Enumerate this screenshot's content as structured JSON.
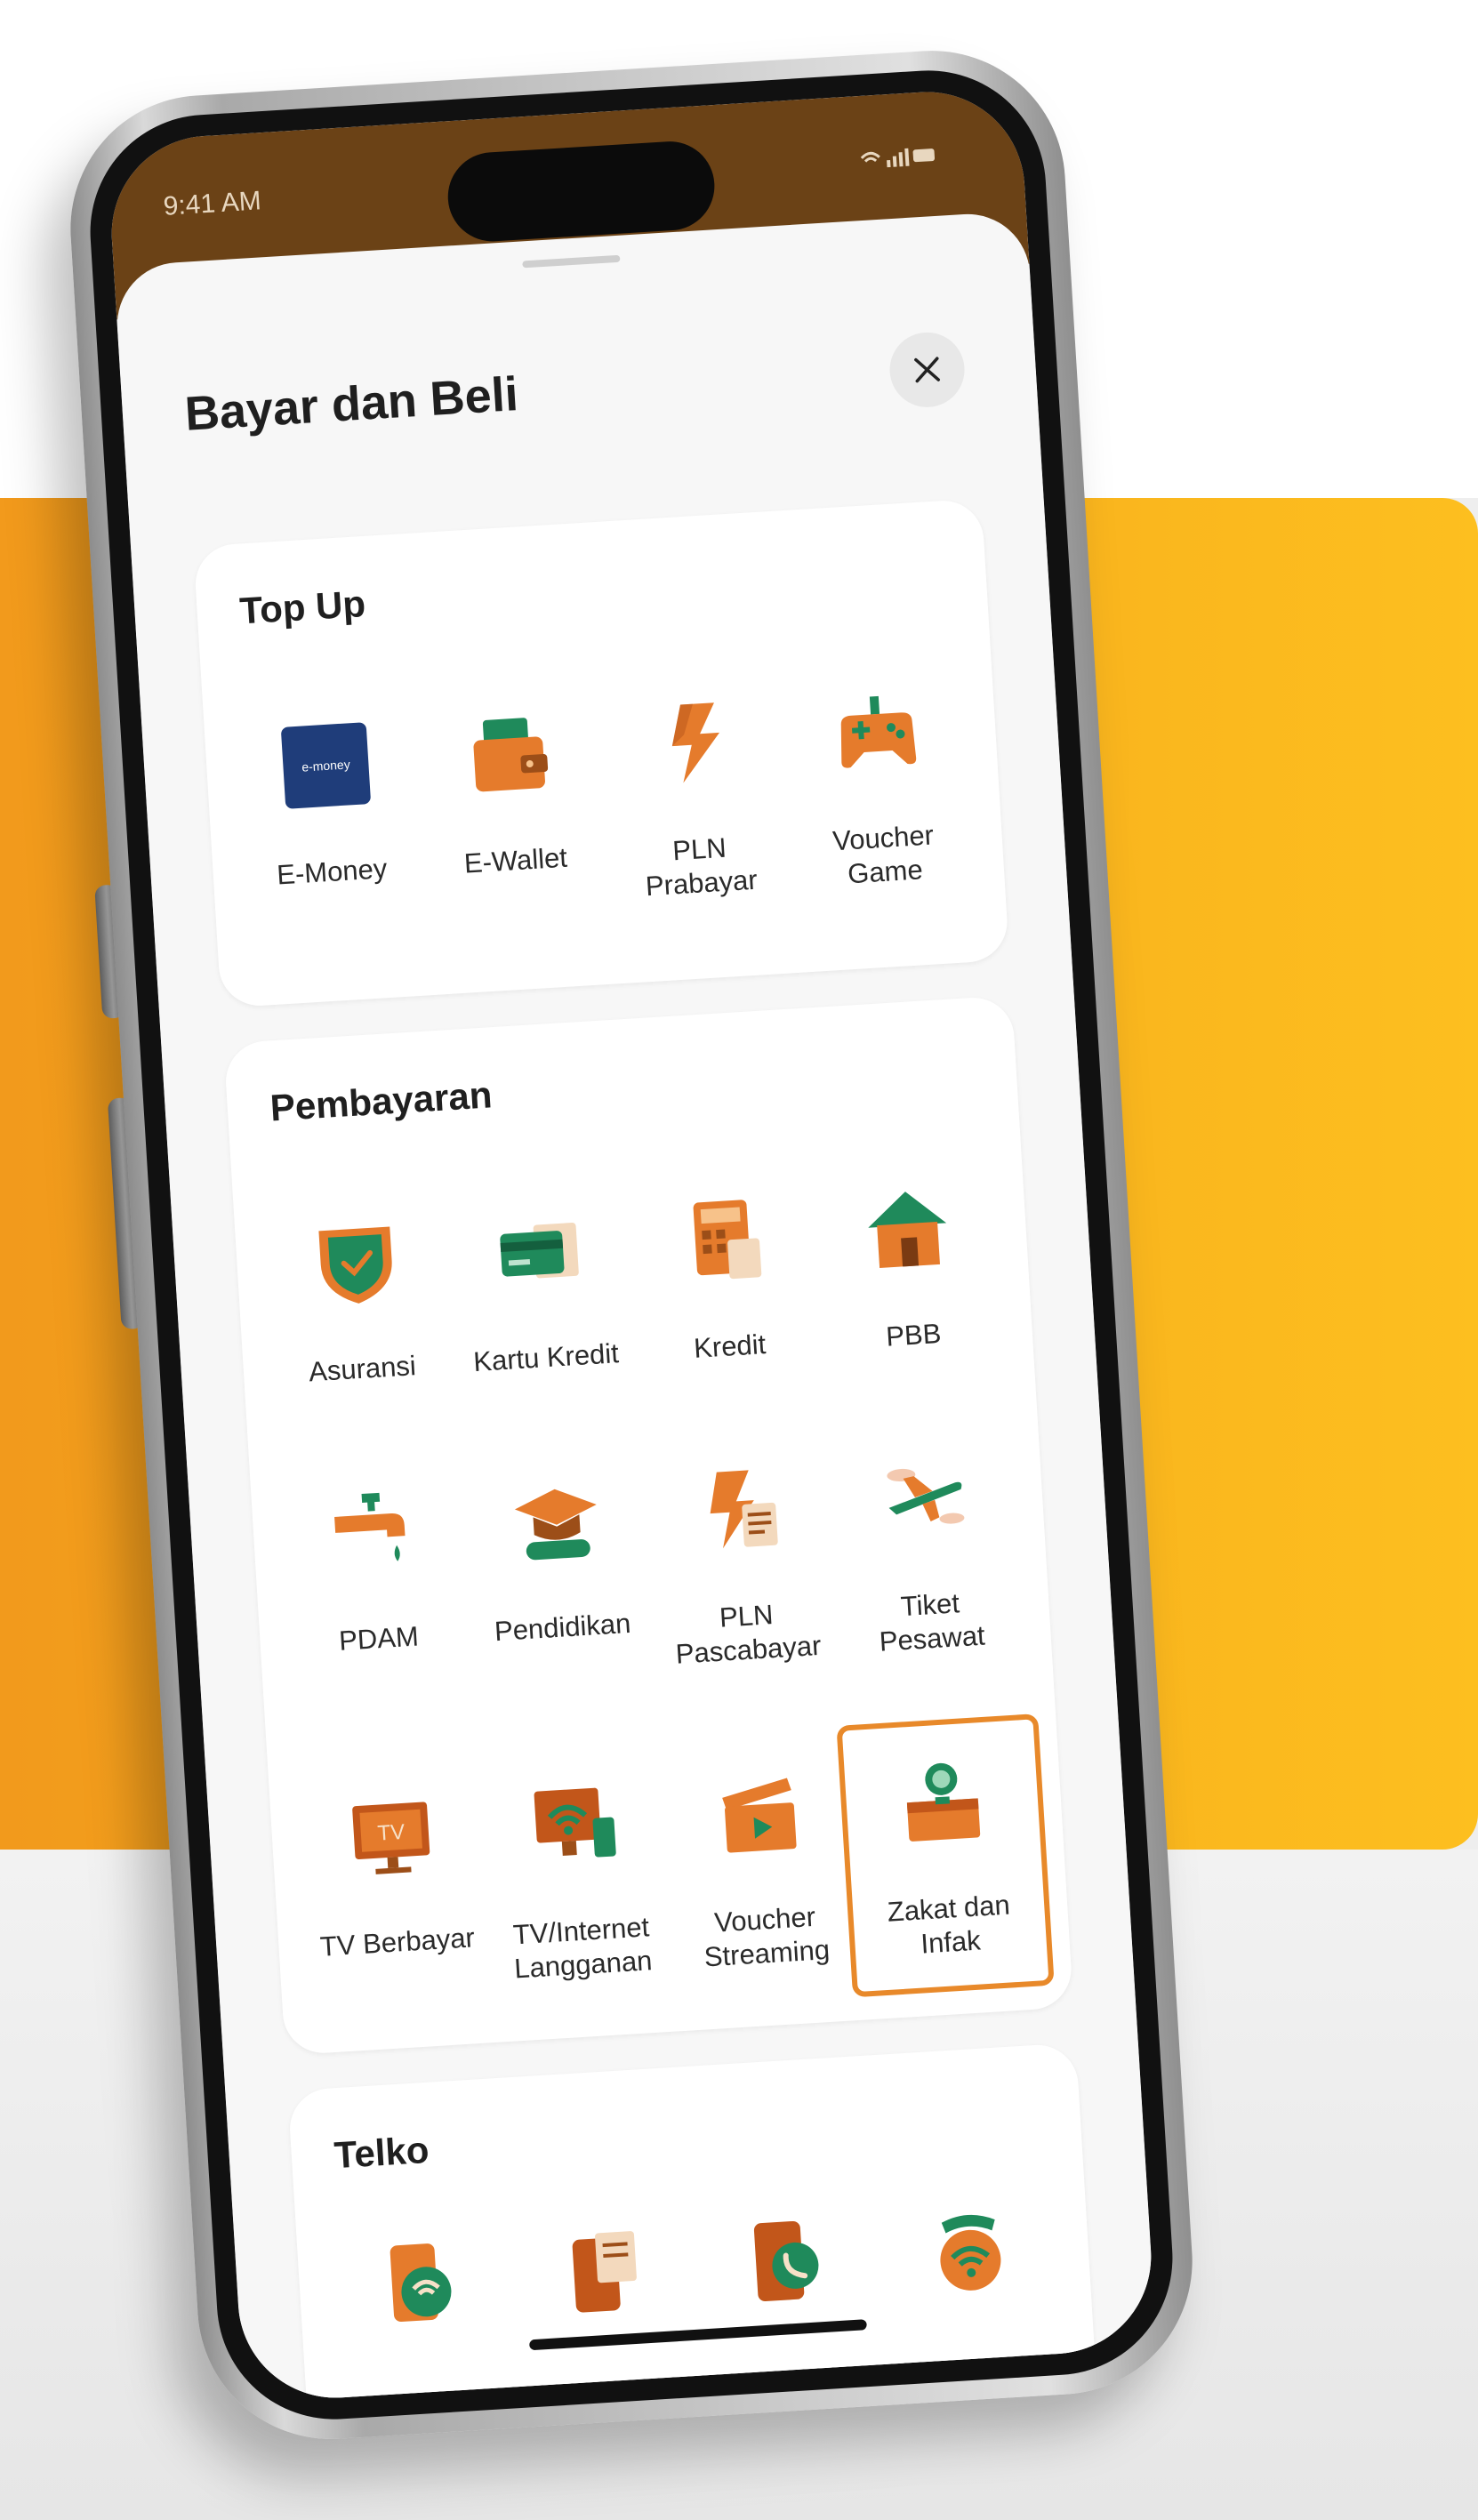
{
  "status": {
    "time": "9:41 AM",
    "icons": "•• ▮"
  },
  "sheet": {
    "title": "Bayar dan Beli",
    "close_icon": "close-icon"
  },
  "top_up": {
    "title": "Top Up",
    "items": [
      {
        "label": "E-Money",
        "icon": "e-money-card-icon"
      },
      {
        "label": "E-Wallet",
        "icon": "wallet-icon"
      },
      {
        "label": "PLN Prabayar",
        "icon": "lightning-icon"
      },
      {
        "label": "Voucher Game",
        "icon": "gamepad-icon"
      }
    ],
    "emoney_logo_text": "e-money"
  },
  "pembayaran": {
    "title": "Pembayaran",
    "items": [
      {
        "label": "Asuransi",
        "icon": "shield-icon"
      },
      {
        "label": "Kartu Kredit",
        "icon": "credit-card-icon"
      },
      {
        "label": "Kredit",
        "icon": "calculator-icon"
      },
      {
        "label": "PBB",
        "icon": "house-icon"
      },
      {
        "label": "PDAM",
        "icon": "faucet-icon"
      },
      {
        "label": "Pendidikan",
        "icon": "graduation-cap-icon"
      },
      {
        "label": "PLN Pascabayar",
        "icon": "bill-lightning-icon"
      },
      {
        "label": "Tiket Pesawat",
        "icon": "airplane-icon"
      },
      {
        "label": "TV Berbayar",
        "icon": "tv-icon"
      },
      {
        "label": "TV/Internet Langganan",
        "icon": "wifi-monitor-icon"
      },
      {
        "label": "Voucher Streaming",
        "icon": "clapperboard-icon"
      },
      {
        "label": "Zakat dan Infak",
        "icon": "donation-box-icon",
        "highlighted": true
      }
    ],
    "tv_text": "TV"
  },
  "telko": {
    "title": "Telko",
    "items": [
      {
        "icon": "phone-wifi-icon"
      },
      {
        "icon": "phone-bill-icon"
      },
      {
        "icon": "phone-call-icon"
      },
      {
        "icon": "wifi-router-icon"
      }
    ]
  },
  "colors": {
    "brand_orange": "#e8892a",
    "icon_green": "#1f8a5b",
    "icon_orange": "#e57b2c",
    "status_brown": "#6b4216",
    "band_orange": "#f6ab1d"
  }
}
